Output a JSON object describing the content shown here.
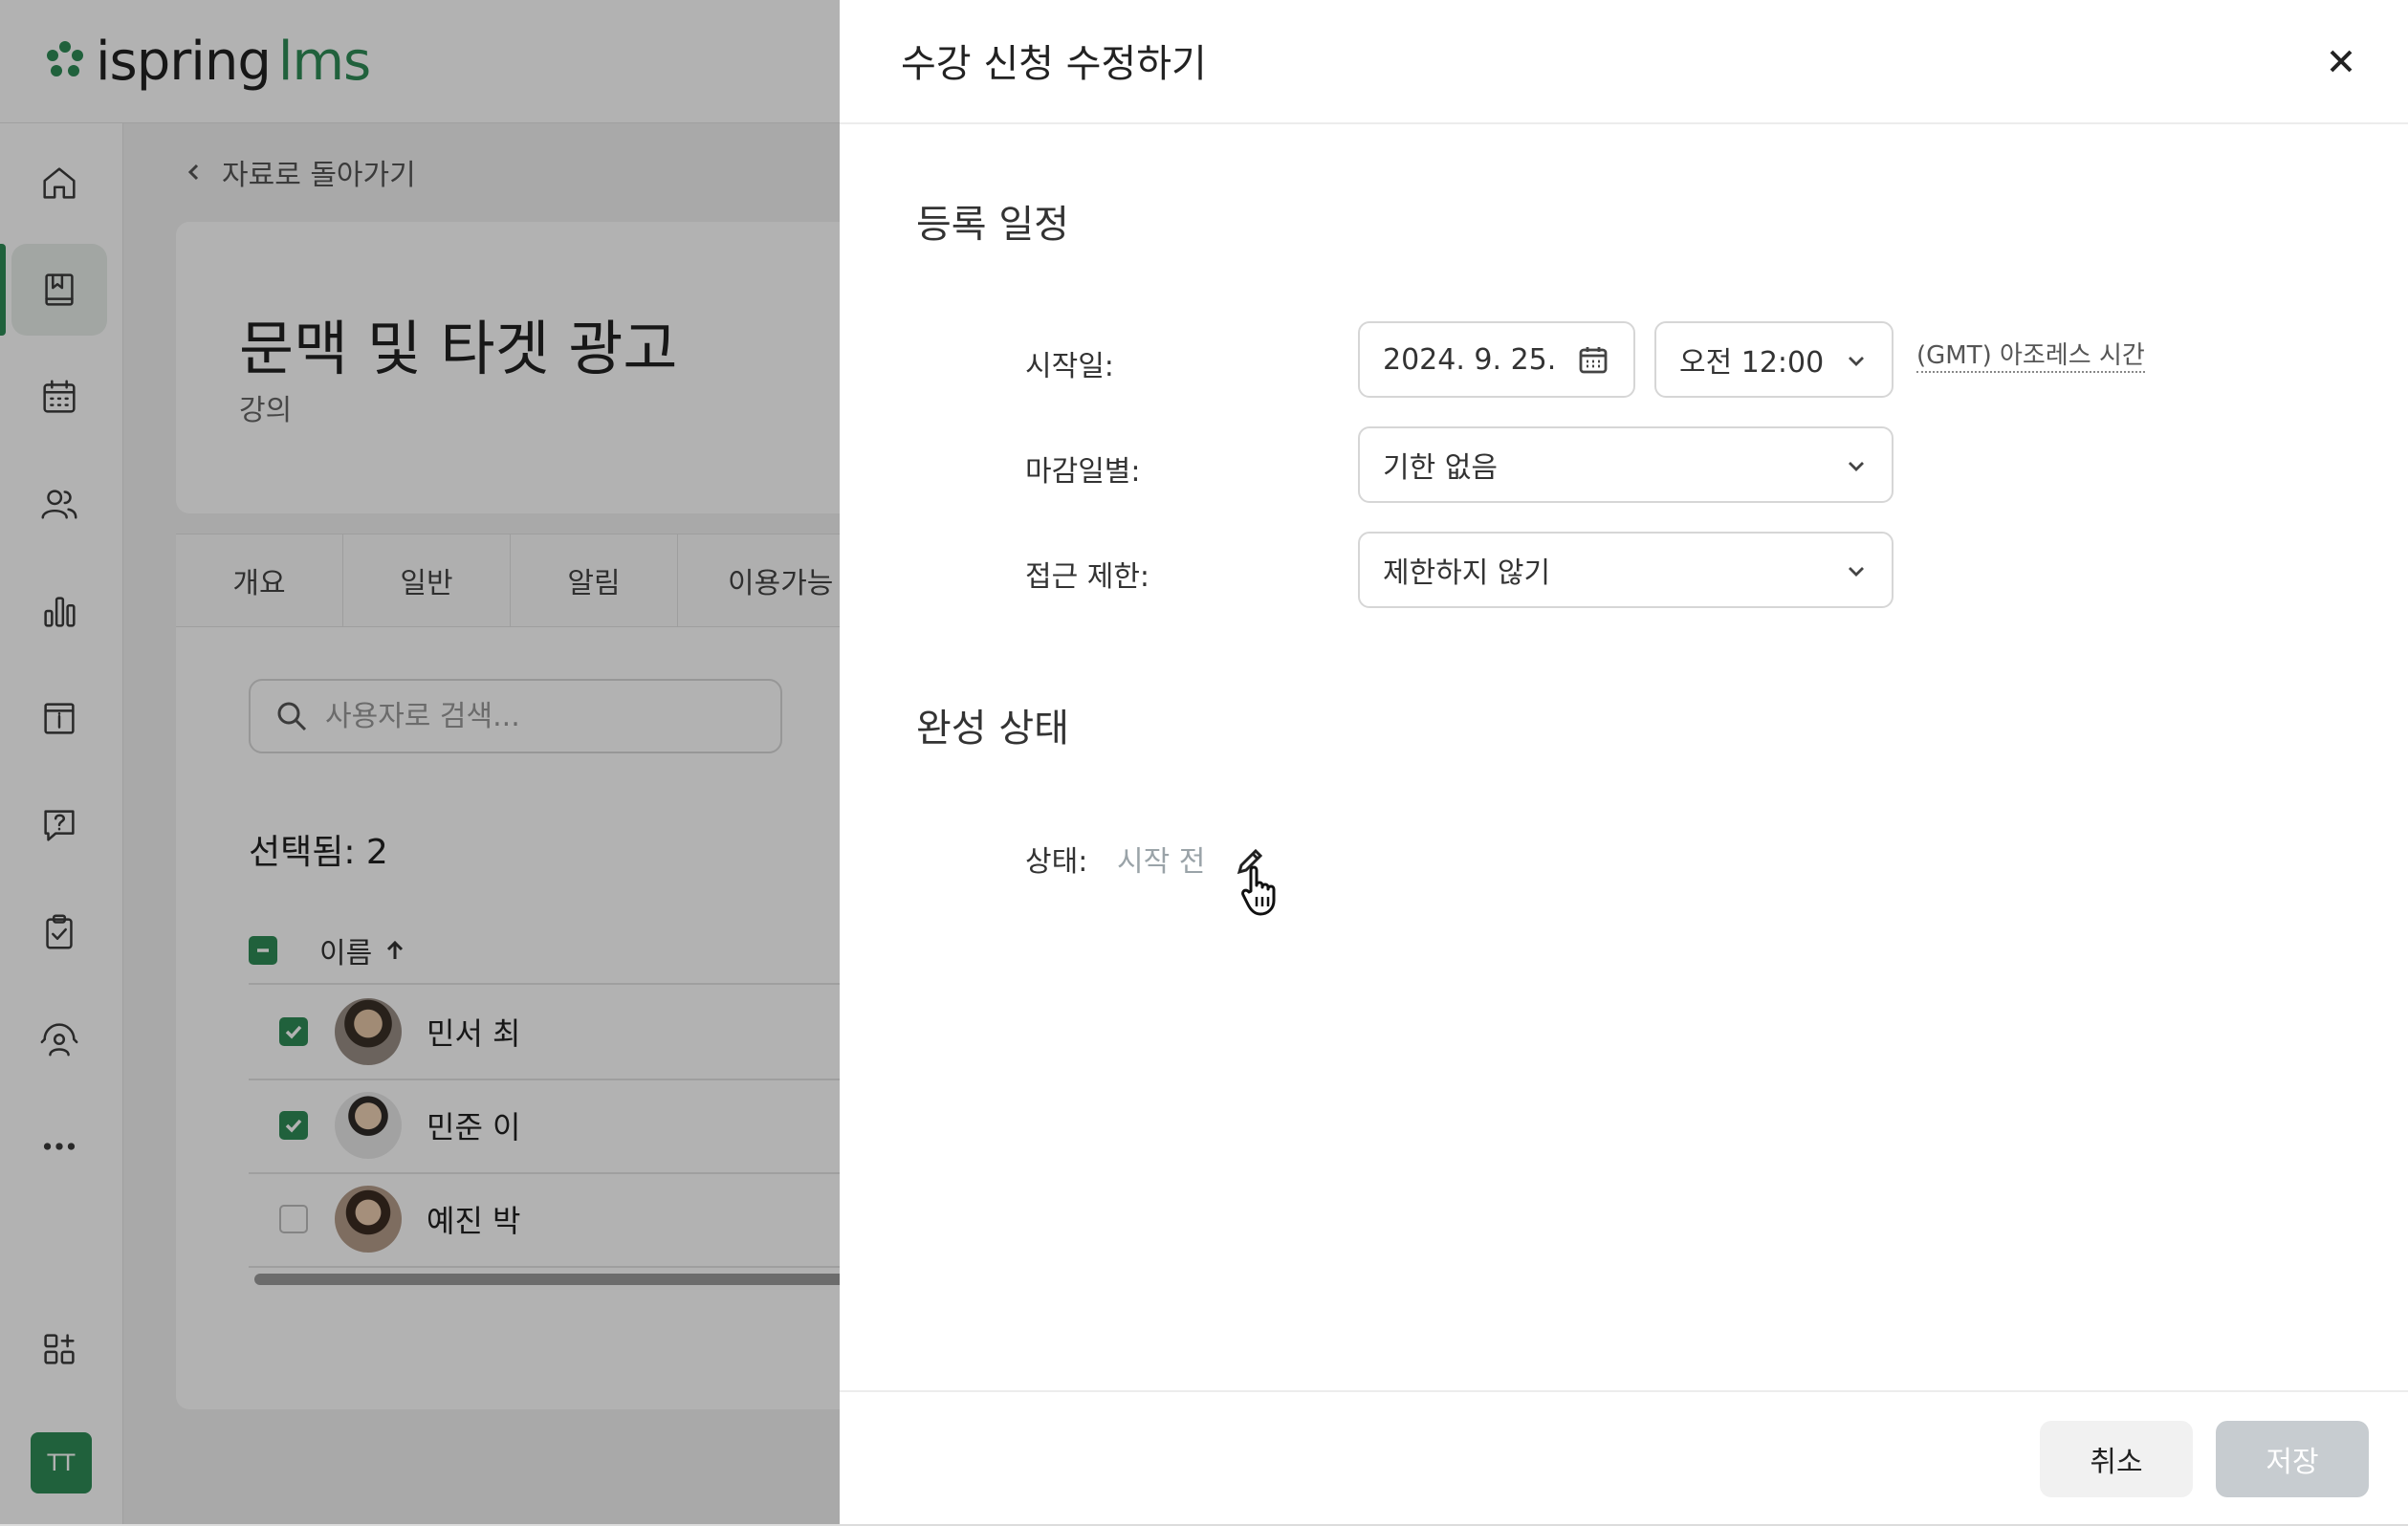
{
  "brand": {
    "name_part1": "ispring",
    "name_part2": "lms",
    "accent": "#2e8b57"
  },
  "sidebar": {
    "items": [
      {
        "icon": "home-icon"
      },
      {
        "icon": "book-icon",
        "active": true
      },
      {
        "icon": "calendar-icon"
      },
      {
        "icon": "users-icon"
      },
      {
        "icon": "bar-chart-icon"
      },
      {
        "icon": "info-board-icon"
      },
      {
        "icon": "help-chat-icon"
      },
      {
        "icon": "clipboard-check-icon"
      },
      {
        "icon": "coach-icon"
      },
      {
        "icon": "more-icon"
      },
      {
        "icon": "apps-add-icon"
      }
    ],
    "user_initials": "TT"
  },
  "main": {
    "back_label": "자료로 돌아가기",
    "course_title": "문맥 및 타겟 광고",
    "course_type": "강의",
    "tabs": [
      "개요",
      "일반",
      "알림",
      "이용가능"
    ],
    "search_placeholder": "사용자로 검색...",
    "selected_label": "선택됨: 2",
    "list_header": "이름",
    "users": [
      {
        "name": "민서 최",
        "checked": true
      },
      {
        "name": "민준 이",
        "checked": true
      },
      {
        "name": "예진 박",
        "checked": false
      }
    ]
  },
  "modal": {
    "title": "수강 신청 수정하기",
    "schedule_section": "등록 일정",
    "start_label": "시작일:",
    "start_date": "2024. 9. 25.",
    "start_time": "오전 12:00",
    "timezone": "(GMT) 아조레스 시간",
    "deadline_label": "마감일별:",
    "deadline_value": "기한 없음",
    "access_label": "접근 제한:",
    "access_value": "제한하지 않기",
    "completion_section": "완성 상태",
    "status_label": "상태:",
    "status_value": "시작 전",
    "cancel_label": "취소",
    "save_label": "저장"
  }
}
